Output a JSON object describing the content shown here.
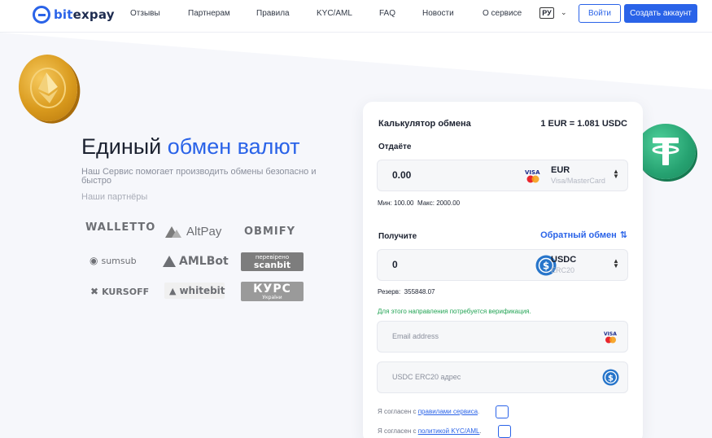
{
  "header": {
    "logo_text_prefix": "bit",
    "logo_text_suffix": "expay",
    "nav": [
      "Отзывы",
      "Партнерам",
      "Правила",
      "KYC/AML",
      "FAQ",
      "Новости",
      "О сервисе"
    ],
    "lang": "РУ",
    "login": "Войти",
    "create_account": "Создать аккаунт"
  },
  "hero": {
    "title_part1": "Единый ",
    "title_part2": "обмен валют",
    "subtitle": "Наш Сервис помогает производить обмены безопасно и быстро",
    "partners_title": "Наши партнёры"
  },
  "partners": [
    "WALLETTO",
    "AltPay",
    "OBMIFY",
    "sumsub",
    "AMLBot",
    "перевірено",
    "scanbit",
    "KURSOFF",
    "whitebit",
    "КУРС",
    "України"
  ],
  "calculator": {
    "title": "Калькулятор обмена",
    "rate": "1 EUR = 1.081 USDC",
    "give_label": "Отдаёте",
    "give_amount": "0.00",
    "give_currency": "EUR",
    "give_currency_sub": "Visa/MasterCard",
    "min_label": "Мин:",
    "min_value": "100.00",
    "max_label": "Макс:",
    "max_value": "2000.00",
    "get_label": "Получите",
    "reverse_label": "Обратный обмен",
    "get_amount": "0",
    "get_currency": "USDC",
    "get_currency_sub": "ERC20",
    "reserve_label": "Резерв:",
    "reserve_value": "355848.07",
    "verify_note": "Для этого направления потребуется верификация.",
    "email_placeholder": "Email address",
    "address_placeholder": "USDC ERC20 адрес",
    "agree1_text": "Я согласен с ",
    "agree1_link": "правилами сервиса",
    "agree2_text": "Я согласен с ",
    "agree2_link": "политикой KYC/AML",
    "visa_text": "VISA"
  },
  "colors": {
    "accent": "#2a63e8",
    "success": "#23a455",
    "usdt": "#26a271",
    "eth_gold": "#d99a1d"
  }
}
